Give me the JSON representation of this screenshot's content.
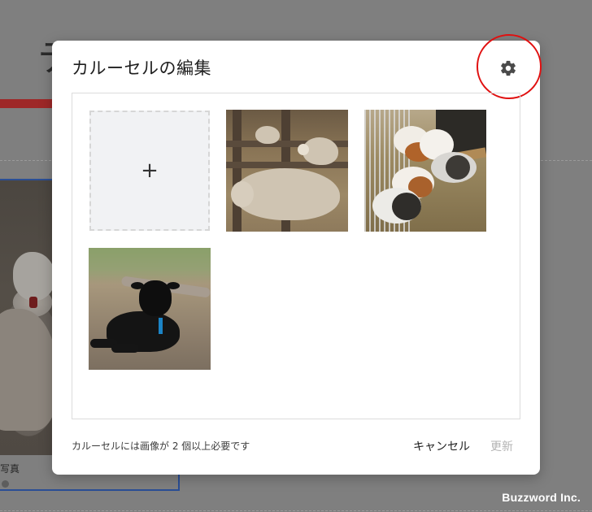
{
  "background": {
    "heading_fragment": "テ",
    "caption_fragment": "写真"
  },
  "dialog": {
    "title": "カルーセルの編集",
    "settings_icon": "gear-icon",
    "add_tile_label": "+",
    "images": [
      {
        "subject": "sheep"
      },
      {
        "subject": "guinea-pigs"
      },
      {
        "subject": "black-lamb"
      }
    ],
    "requirement_note": "カルーセルには画像が 2 個以上必要です",
    "cancel_label": "キャンセル",
    "update_label": "更新",
    "update_enabled": false
  },
  "watermark": "Buzzword Inc.",
  "colors": {
    "overlay": "#7f7f7f",
    "highlight_ring": "#e01010",
    "disabled_text": "#b3b3b3"
  }
}
